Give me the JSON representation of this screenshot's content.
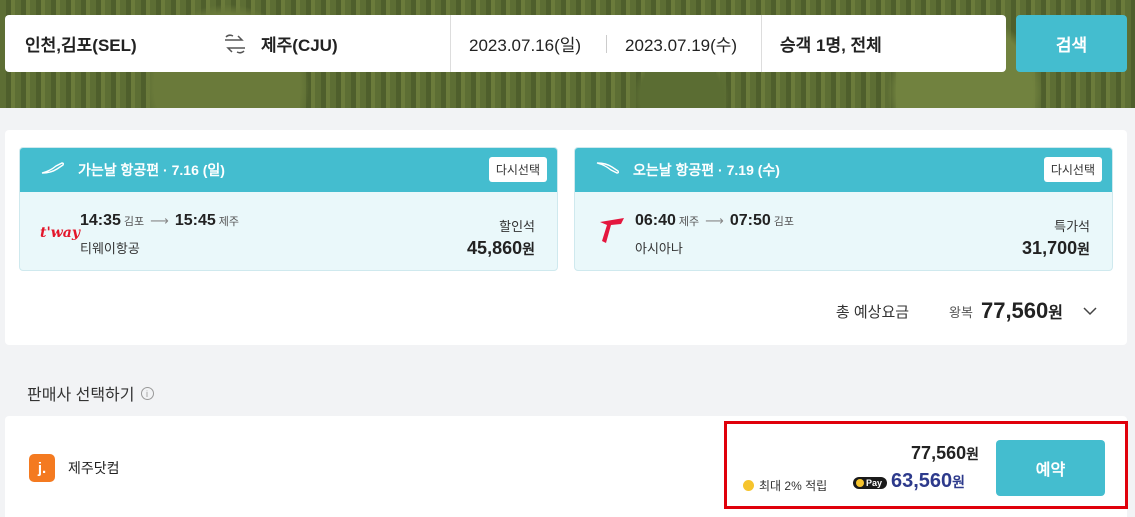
{
  "search": {
    "origin": "인천,김포(SEL)",
    "destination": "제주(CJU)",
    "depart_date": "2023.07.16(일)",
    "return_date": "2023.07.19(수)",
    "passengers": "승객 1명, 전체",
    "search_label": "검색"
  },
  "outbound": {
    "header": "가는날 항공편 · 7.16 (일)",
    "reselect_label": "다시선택",
    "logo_text": "t'way",
    "dep_time": "14:35",
    "dep_airport": "김포",
    "arr_time": "15:45",
    "arr_airport": "제주",
    "airline": "티웨이항공",
    "seat_class": "할인석",
    "price": "45,860",
    "currency": "원"
  },
  "inbound": {
    "header": "오는날 항공편 · 7.19 (수)",
    "reselect_label": "다시선택",
    "dep_time": "06:40",
    "dep_airport": "제주",
    "arr_time": "07:50",
    "arr_airport": "김포",
    "airline": "아시아나",
    "seat_class": "특가석",
    "price": "31,700",
    "currency": "원"
  },
  "total": {
    "label": "총 예상요금",
    "trip_type": "왕복",
    "amount": "77,560",
    "currency": "원"
  },
  "sellers": {
    "title": "판매사 선택하기",
    "info_icon": "i",
    "items": [
      {
        "logo_text": "j.",
        "name": "제주닷컴",
        "price": "77,560",
        "currency": "원",
        "reward": "최대 2% 적립",
        "pay_badge": "Pay",
        "pay_price": "63,560",
        "pay_currency": "원",
        "book_label": "예약"
      }
    ]
  },
  "colors": {
    "accent": "#44bdcf",
    "highlight_border": "#e0000b",
    "pay_price": "#2d3a8c"
  }
}
